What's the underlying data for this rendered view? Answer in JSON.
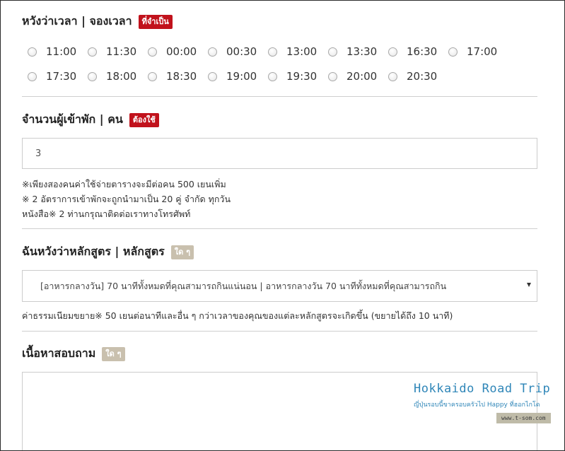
{
  "time_section": {
    "heading": "หวังว่าเวลา | จองเวลา",
    "badge": "ที่จำเป็น",
    "row1": [
      "11:00",
      "11:30",
      "00:00",
      "00:30",
      "13:00",
      "13:30",
      "16:30",
      "17:00"
    ],
    "row2": [
      "17:30",
      "18:00",
      "18:30",
      "19:00",
      "19:30",
      "20:00",
      "20:30"
    ]
  },
  "guests_section": {
    "heading": "จำนวนผู้เข้าพัก | คน",
    "badge": "ต้องใช้",
    "value": "3",
    "notes": [
      "※เพียงสองคนค่าใช้จ่ายตารางจะมีต่อคน 500 เยนเพิ่ม",
      "※ 2 อัตราการเข้าพักจะถูกนำมาเป็น 20 คู่ จำกัด ทุกวัน",
      "หนังสือ※ 2 ท่านกรุณาติดต่อเราทางโทรศัพท์"
    ]
  },
  "course_section": {
    "heading": "ฉันหวังว่าหลักสูตร | หลักสูตร",
    "badge": "ใด ๆ",
    "selected": "[อาหารกลางวัน] 70 นาทีทั้งหมดที่คุณสามารถกินแน่นอน | อาหารกลางวัน 70 นาทีทั้งหมดที่คุณสามารถกิน",
    "note": "ค่าธรรมเนียมขยาย※ 50 เยนต่อนาทีและอื่น ๆ กว่าเวลาของคุณของแต่ละหลักสูตรจะเกิดขึ้น (ขยายได้ถึง 10 นาที)"
  },
  "inquiry_section": {
    "heading": "เนื้อหาสอบถาม",
    "badge": "ใด ๆ",
    "value": ""
  },
  "watermark": {
    "title": "Hokkaido Road Trip",
    "subtitle": "ญี่ปุ่นรอบนี้ขาครอบครัวไป Happy ที่ฮอกไกโด",
    "url": "www.t-som.com"
  },
  "colors": {
    "required_badge": "#c1121c",
    "optional_badge": "#c9c0ae",
    "watermark": "#2f86b8"
  }
}
